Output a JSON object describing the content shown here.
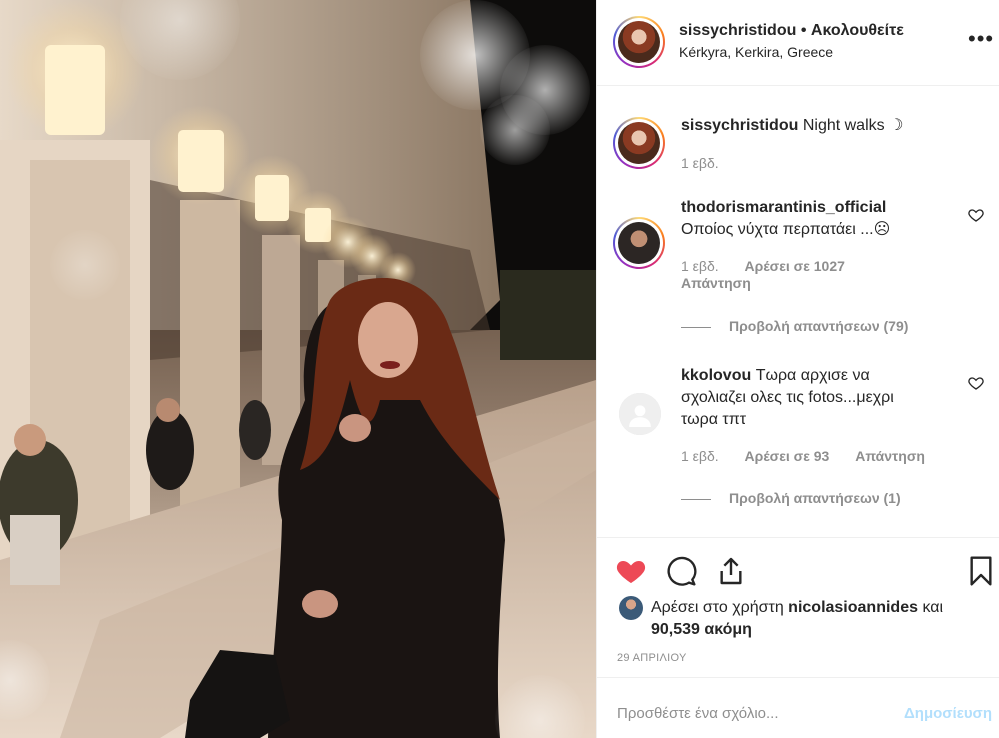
{
  "post": {
    "username": "sissychristidou",
    "follow_separator": "•",
    "follow_status": "Ακολουθείτε",
    "location": "Kérkyra, Kerkira, Greece",
    "more_icon": "ellipsis-icon"
  },
  "caption": {
    "username": "sissychristidou",
    "text": "Night walks",
    "emoji": "☽",
    "time": "1 εβδ."
  },
  "comments": [
    {
      "username": "thodorismarantinis_official",
      "text": "Οποίος νύχτα περπατάει ...☹",
      "time": "1 εβδ.",
      "likes": "Αρέσει σε 1027",
      "reply": "Απάντηση",
      "view_replies": "Προβολή απαντήσεων (79)"
    },
    {
      "username": "kkolovou",
      "text": "Τωρα αρχισε να σχολιαζει ολες τις fotos...μεχρι τωρα τπτ",
      "time": "1 εβδ.",
      "likes": "Αρέσει σε 93",
      "reply": "Απάντηση",
      "view_replies": "Προβολή απαντήσεων (1)"
    }
  ],
  "likes": {
    "prefix": "Αρέσει στο χρήστη",
    "user": "nicolasioannides",
    "middle": "και",
    "count": "90,539 ακόμη"
  },
  "date": "29 ΑΠΡΙΛΙΟΥ",
  "add_comment": {
    "placeholder": "Προσθέστε ένα σχόλιο...",
    "post_label": "Δημοσίευση"
  },
  "colors": {
    "like_red": "#ed4956",
    "link_blue_disabled": "#b2dffc",
    "secondary_text": "#8e8e8e"
  }
}
